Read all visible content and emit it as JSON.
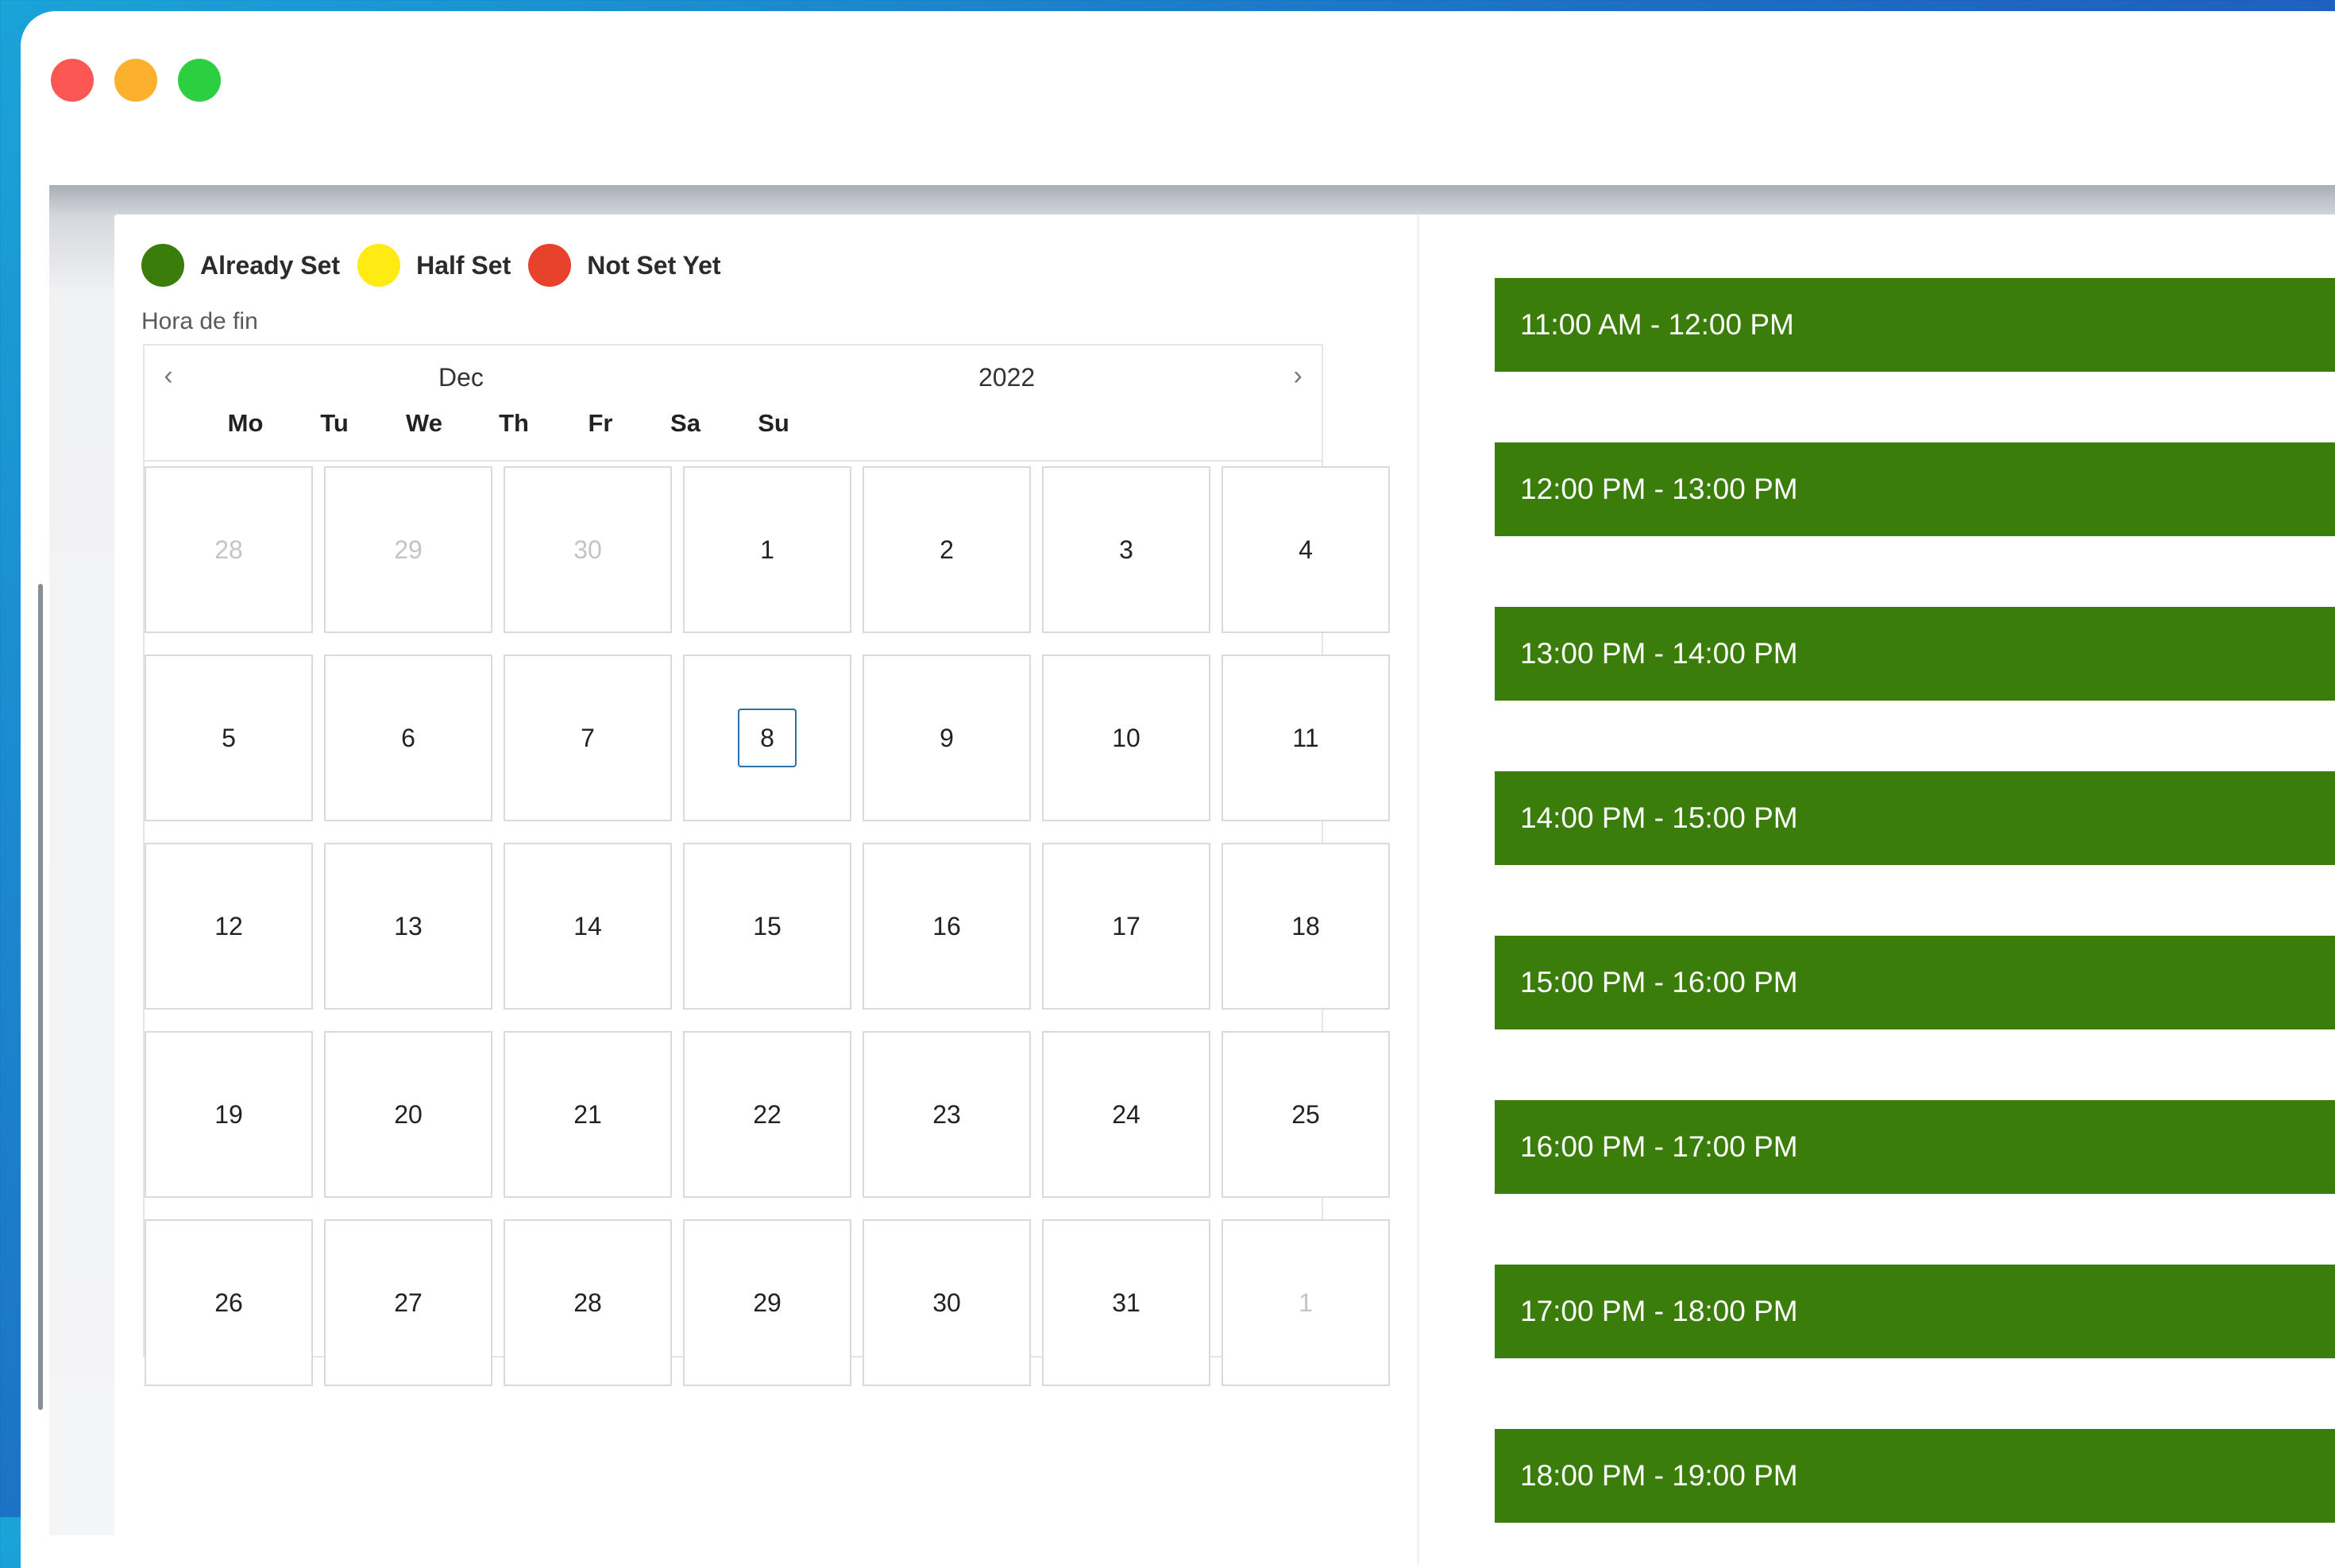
{
  "legend": [
    {
      "label": "Already Set",
      "color": "#3a7d0a"
    },
    {
      "label": "Half Set",
      "color": "#ffea14"
    },
    {
      "label": "Not Set Yet",
      "color": "#e7422c"
    }
  ],
  "field_label": "Hora de fin",
  "calendar": {
    "month": "Dec",
    "year": "2022",
    "prev_icon": "chevron-left-icon",
    "next_icon": "chevron-right-icon",
    "weekdays": [
      "Mo",
      "Tu",
      "We",
      "Th",
      "Fr",
      "Sa",
      "Su"
    ],
    "weeks": [
      [
        "28",
        "29",
        "30",
        "1",
        "2",
        "3",
        "4"
      ],
      [
        "5",
        "6",
        "7",
        "8",
        "9",
        "10",
        "11"
      ],
      [
        "12",
        "13",
        "14",
        "15",
        "16",
        "17",
        "18"
      ],
      [
        "19",
        "20",
        "21",
        "22",
        "23",
        "24",
        "25"
      ],
      [
        "26",
        "27",
        "28",
        "29",
        "30",
        "31",
        "1"
      ]
    ],
    "outside_month": [
      [
        0,
        0
      ],
      [
        0,
        1
      ],
      [
        0,
        2
      ],
      [
        4,
        6
      ]
    ],
    "highlighted_day": "8"
  },
  "time_slots": [
    {
      "label": "11:00 AM - 12:00 PM",
      "status": "Already Set"
    },
    {
      "label": "12:00 PM - 13:00 PM",
      "status": "Already Set"
    },
    {
      "label": "13:00 PM - 14:00 PM",
      "status": "Already Set"
    },
    {
      "label": "14:00 PM - 15:00 PM",
      "status": "Already Set"
    },
    {
      "label": "15:00 PM - 16:00 PM",
      "status": "Already Set"
    },
    {
      "label": "16:00 PM - 17:00 PM",
      "status": "Already Set"
    },
    {
      "label": "17:00 PM - 18:00 PM",
      "status": "Already Set"
    },
    {
      "label": "18:00 PM - 19:00 PM",
      "status": "Already Set"
    }
  ]
}
